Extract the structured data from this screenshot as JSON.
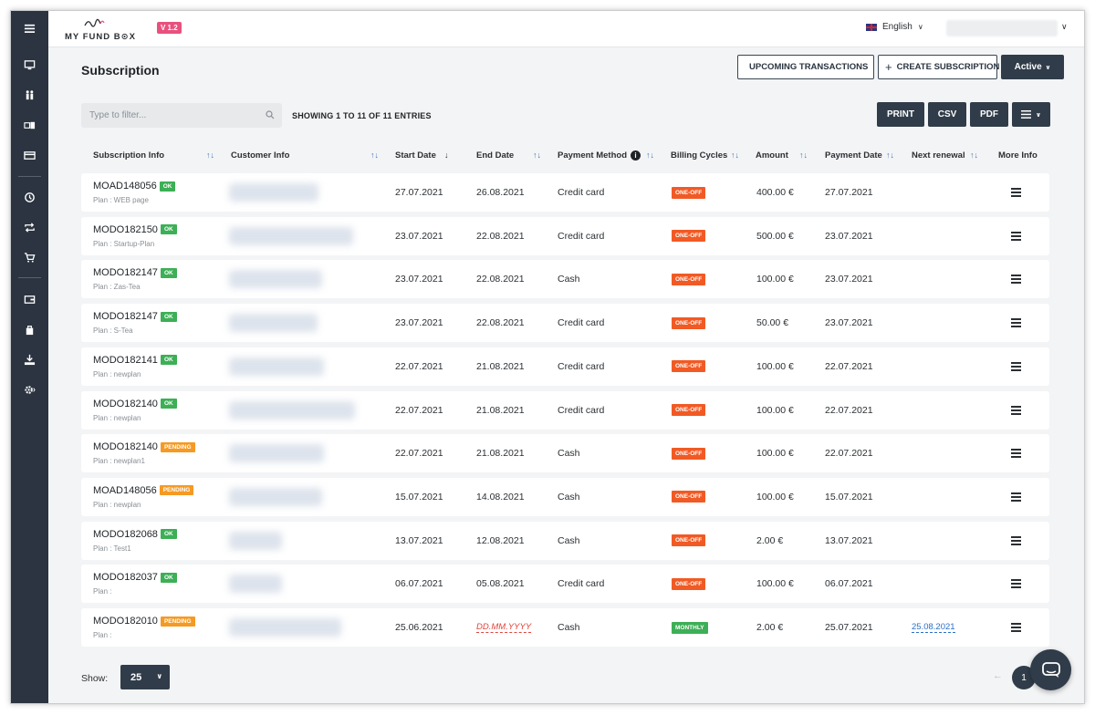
{
  "app": {
    "logo_text": "MY FUND B⊙X",
    "version": "V 1.2",
    "language": "English"
  },
  "page": {
    "title": "Subscription",
    "buttons": {
      "upcoming": "UPCOMING TRANSACTIONS",
      "create": "CREATE SUBSCRIPTION",
      "status": "Active"
    },
    "filter_placeholder": "Type to filter...",
    "showing": "SHOWING 1 TO 11 OF 11 ENTRIES",
    "export": {
      "print": "PRINT",
      "csv": "CSV",
      "pdf": "PDF"
    }
  },
  "columns": {
    "sub_info": "Subscription Info",
    "customer_info": "Customer Info",
    "start_date": "Start Date",
    "end_date": "End Date",
    "payment_method": "Payment Method",
    "billing_cycles": "Billing Cycles",
    "amount": "Amount",
    "payment_date": "Payment Date",
    "next_renewal": "Next renewal",
    "more_info": "More Info"
  },
  "colors": {
    "ok": "#3daf56",
    "pending": "#f59a24",
    "oneoff": "#f15a24",
    "monthly": "#3daf56"
  },
  "rows": [
    {
      "id": "MOAD148056",
      "status": "OK",
      "status_color": "#3daf56",
      "plan": "Plan : WEB page",
      "start": "27.07.2021",
      "end": "26.08.2021",
      "method": "Credit card",
      "cycle": "ONE-OFF",
      "cycle_color": "#f15a24",
      "amount": "400.00 €",
      "pay_date": "27.07.2021",
      "renewal": ""
    },
    {
      "id": "MODO182150",
      "status": "OK",
      "status_color": "#3daf56",
      "plan": "Plan : Startup-Plan",
      "start": "23.07.2021",
      "end": "22.08.2021",
      "method": "Credit card",
      "cycle": "ONE-OFF",
      "cycle_color": "#f15a24",
      "amount": "500.00 €",
      "pay_date": "23.07.2021",
      "renewal": ""
    },
    {
      "id": "MODO182147",
      "status": "OK",
      "status_color": "#3daf56",
      "plan": "Plan : Zas-Tea",
      "start": "23.07.2021",
      "end": "22.08.2021",
      "method": "Cash",
      "cycle": "ONE-OFF",
      "cycle_color": "#f15a24",
      "amount": "100.00 €",
      "pay_date": "23.07.2021",
      "renewal": ""
    },
    {
      "id": "MODO182147",
      "status": "OK",
      "status_color": "#3daf56",
      "plan": "Plan : S-Tea",
      "start": "23.07.2021",
      "end": "22.08.2021",
      "method": "Credit card",
      "cycle": "ONE-OFF",
      "cycle_color": "#f15a24",
      "amount": "50.00 €",
      "pay_date": "23.07.2021",
      "renewal": ""
    },
    {
      "id": "MODO182141",
      "status": "OK",
      "status_color": "#3daf56",
      "plan": "Plan : newplan",
      "start": "22.07.2021",
      "end": "21.08.2021",
      "method": "Credit card",
      "cycle": "ONE-OFF",
      "cycle_color": "#f15a24",
      "amount": "100.00 €",
      "pay_date": "22.07.2021",
      "renewal": ""
    },
    {
      "id": "MODO182140",
      "status": "OK",
      "status_color": "#3daf56",
      "plan": "Plan : newplan",
      "start": "22.07.2021",
      "end": "21.08.2021",
      "method": "Credit card",
      "cycle": "ONE-OFF",
      "cycle_color": "#f15a24",
      "amount": "100.00 €",
      "pay_date": "22.07.2021",
      "renewal": ""
    },
    {
      "id": "MODO182140",
      "status": "PENDING",
      "status_color": "#f59a24",
      "plan": "Plan : newplan1",
      "start": "22.07.2021",
      "end": "21.08.2021",
      "method": "Cash",
      "cycle": "ONE-OFF",
      "cycle_color": "#f15a24",
      "amount": "100.00 €",
      "pay_date": "22.07.2021",
      "renewal": ""
    },
    {
      "id": "MOAD148056",
      "status": "PENDING",
      "status_color": "#f59a24",
      "plan": "Plan : newplan",
      "start": "15.07.2021",
      "end": "14.08.2021",
      "method": "Cash",
      "cycle": "ONE-OFF",
      "cycle_color": "#f15a24",
      "amount": "100.00 €",
      "pay_date": "15.07.2021",
      "renewal": ""
    },
    {
      "id": "MODO182068",
      "status": "OK",
      "status_color": "#3daf56",
      "plan": "Plan : Test1",
      "start": "13.07.2021",
      "end": "12.08.2021",
      "method": "Cash",
      "cycle": "ONE-OFF",
      "cycle_color": "#f15a24",
      "amount": "2.00 €",
      "pay_date": "13.07.2021",
      "renewal": ""
    },
    {
      "id": "MODO182037",
      "status": "OK",
      "status_color": "#3daf56",
      "plan": "Plan :",
      "start": "06.07.2021",
      "end": "05.08.2021",
      "method": "Credit card",
      "cycle": "ONE-OFF",
      "cycle_color": "#f15a24",
      "amount": "100.00 €",
      "pay_date": "06.07.2021",
      "renewal": ""
    },
    {
      "id": "MODO182010",
      "status": "PENDING",
      "status_color": "#f59a24",
      "plan": "Plan :",
      "start": "25.06.2021",
      "end": "DD.MM.YYYY",
      "method": "Cash",
      "cycle": "MONTHLY",
      "cycle_color": "#3daf56",
      "amount": "2.00 €",
      "pay_date": "25.07.2021",
      "renewal": "25.08.2021"
    }
  ],
  "footer": {
    "show_label": "Show:",
    "page_size": "25",
    "current_page": "1",
    "prev_arrow": "←"
  },
  "icons": [
    "menu-icon",
    "monitor-icon",
    "users-icon",
    "cards-icon",
    "credit-card-icon",
    "history-icon",
    "repeat-icon",
    "cart-icon",
    "wallet-icon",
    "bag-icon",
    "download-icon",
    "gear-icon",
    "chat-icon",
    "search-icon"
  ]
}
